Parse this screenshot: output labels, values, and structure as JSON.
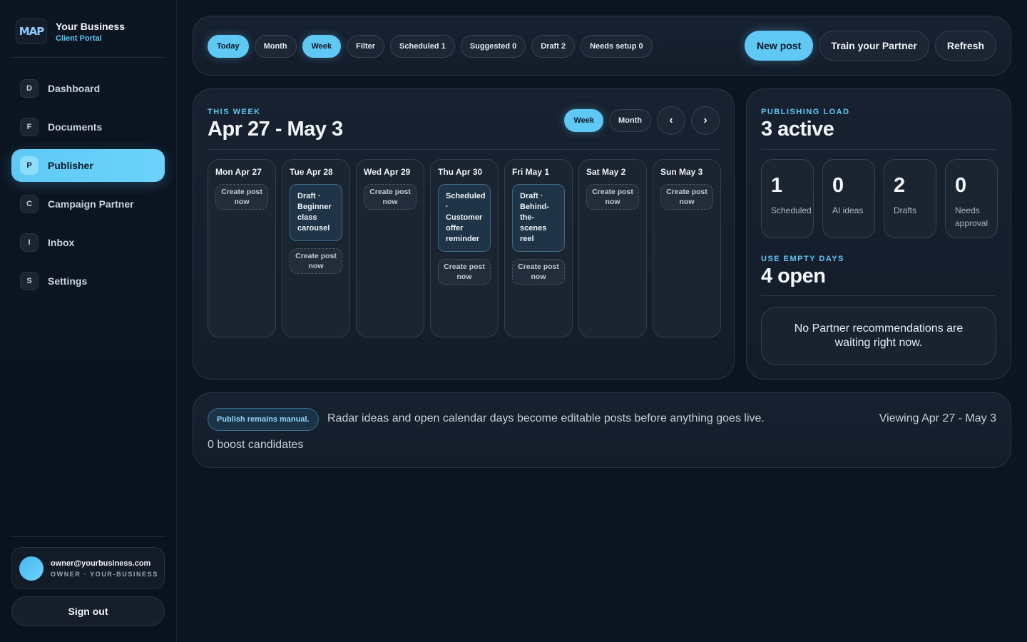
{
  "brand": {
    "logo_text": "MAP",
    "name": "Your Business",
    "subtitle": "Client Portal"
  },
  "nav": [
    {
      "badge": "D",
      "label": "Dashboard"
    },
    {
      "badge": "F",
      "label": "Documents"
    },
    {
      "badge": "P",
      "label": "Publisher",
      "active": true
    },
    {
      "badge": "C",
      "label": "Campaign Partner"
    },
    {
      "badge": "I",
      "label": "Inbox"
    },
    {
      "badge": "S",
      "label": "Settings"
    }
  ],
  "user": {
    "email": "owner@yourbusiness.com",
    "role": "OWNER · YOUR-BUSINESS"
  },
  "signout_label": "Sign out",
  "toolbar": {
    "chips": [
      "Today",
      "Month",
      "Week",
      "Filter",
      "Scheduled 1",
      "Suggested 0",
      "Draft 2",
      "Needs setup 0"
    ],
    "new_post": "New post",
    "train": "Train your Partner",
    "refresh": "Refresh"
  },
  "calendar": {
    "eyebrow": "THIS WEEK",
    "title": "Apr 27 - May 3",
    "week_label": "Week",
    "month_label": "Month",
    "prev": "‹",
    "next": "›",
    "create_label": "Create post now",
    "days": [
      {
        "name": "Mon Apr 27",
        "post": ""
      },
      {
        "name": "Tue Apr 28",
        "post": "Draft · Beginner class carousel"
      },
      {
        "name": "Wed Apr 29",
        "post": ""
      },
      {
        "name": "Thu Apr 30",
        "post": "Scheduled · Customer offer reminder"
      },
      {
        "name": "Fri May 1",
        "post": "Draft · Behind-the-scenes reel"
      },
      {
        "name": "Sat May 2",
        "post": ""
      },
      {
        "name": "Sun May 3",
        "post": ""
      }
    ]
  },
  "load": {
    "eyebrow": "PUBLISHING LOAD",
    "title": "3 active",
    "stats": [
      {
        "num": "1",
        "label": "Scheduled"
      },
      {
        "num": "0",
        "label": "AI ideas"
      },
      {
        "num": "2",
        "label": "Drafts"
      },
      {
        "num": "0",
        "label": "Needs approval"
      }
    ],
    "eyebrow2": "USE EMPTY DAYS",
    "title2": "4 open",
    "recommendation": "No Partner recommendations are waiting right now."
  },
  "footer": {
    "manual": "Publish remains manual.",
    "text": "Radar ideas and open calendar days become editable posts before anything goes live.",
    "viewing": "Viewing Apr 27 - May 3",
    "boost": "0 boost candidates"
  },
  "colors": {
    "accent": "#5fc8f5",
    "background": "#0c1420",
    "panel": "#172130"
  }
}
